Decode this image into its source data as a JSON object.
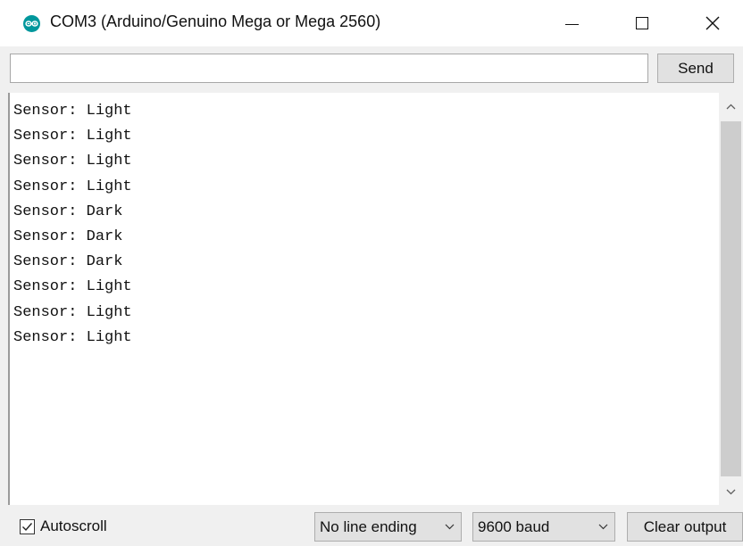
{
  "window": {
    "title": "COM3 (Arduino/Genuino Mega or Mega 2560)",
    "icon": "arduino-icon",
    "accent": "#00979c"
  },
  "send": {
    "input_value": "",
    "button_label": "Send"
  },
  "output": {
    "lines": [
      "Sensor: Light",
      "Sensor: Light",
      "Sensor: Light",
      "Sensor: Light",
      "Sensor: Dark",
      "Sensor: Dark",
      "Sensor: Dark",
      "Sensor: Light",
      "Sensor: Light",
      "Sensor: Light"
    ]
  },
  "footer": {
    "autoscroll_label": "Autoscroll",
    "autoscroll_checked": true,
    "line_ending": "No line ending",
    "baud": "9600 baud",
    "clear_label": "Clear output"
  }
}
